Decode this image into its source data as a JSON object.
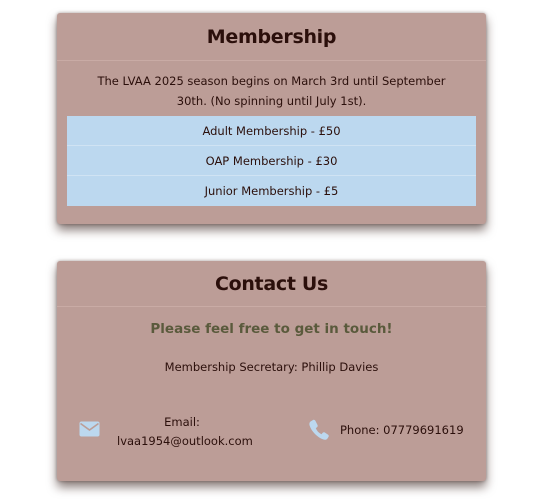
{
  "membership": {
    "title": "Membership",
    "intro": "The LVAA 2025 season begins on March 3rd until September 30th. (No spinning until July 1st).",
    "prices": [
      {
        "label": "Adult Membership - £50"
      },
      {
        "label": "OAP Membership - £30"
      },
      {
        "label": "Junior Membership - £5"
      }
    ]
  },
  "contact": {
    "title": "Contact Us",
    "tagline": "Please feel free to get in touch!",
    "secretary": "Membership Secretary: Phillip Davies",
    "email_label": "Email:",
    "email": "lvaa1954@outlook.com",
    "phone": "Phone: 07779691619",
    "icons": {
      "email": "envelope-icon",
      "phone": "phone-icon"
    },
    "icon_color": "#bcd8ef"
  },
  "colors": {
    "card_bg": "#bc9d97",
    "price_bg": "#bcd8ef",
    "text": "#2b0f0b",
    "tagline": "#5a5a3c"
  }
}
